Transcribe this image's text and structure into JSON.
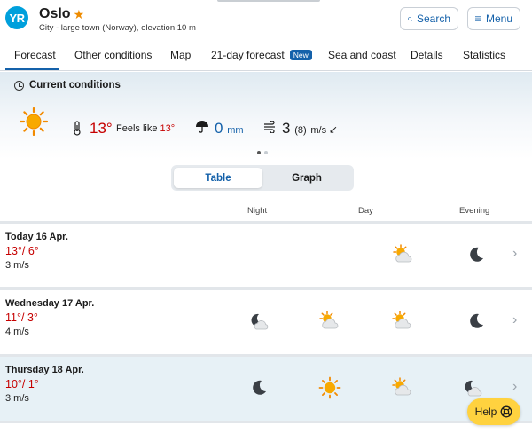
{
  "header": {
    "logo_text": "YR",
    "location": "Oslo",
    "description": "City - large town (Norway), elevation 10 m",
    "search_label": "Search",
    "menu_label": "Menu"
  },
  "tabs": [
    {
      "label": "Forecast",
      "active": true
    },
    {
      "label": "Other conditions"
    },
    {
      "label": "Map"
    },
    {
      "label": "21-day forecast",
      "badge": "New"
    },
    {
      "label": "Sea and coast"
    },
    {
      "label": "Details"
    },
    {
      "label": "Statistics"
    }
  ],
  "current": {
    "title": "Current conditions",
    "icon": "sun-icon",
    "temperature": "13°",
    "feels_like_label": "Feels like",
    "feels_like_value": "13°",
    "precipitation": "0",
    "precipitation_unit": "mm",
    "wind": "3",
    "gust": "(8)",
    "wind_unit": "m/s",
    "wind_direction_icon": "arrow-down-left-icon"
  },
  "view_toggle": {
    "table": "Table",
    "graph": "Graph",
    "selected": "Table"
  },
  "columns": {
    "night": "Night",
    "day": "Day",
    "evening": "Evening"
  },
  "days": [
    {
      "name": "Today 16 Apr.",
      "max": "13°",
      "min": "6°",
      "wind": "3 m/s",
      "night": null,
      "morning": null,
      "day": "partly-cloudy-sun-icon",
      "evening": "moon-icon"
    },
    {
      "name": "Wednesday 17 Apr.",
      "max": "11°",
      "min": "3°",
      "wind": "4 m/s",
      "night": "moon-cloud-icon",
      "morning": "partly-cloudy-sun-icon",
      "day": "partly-cloudy-sun-icon",
      "evening": "moon-icon"
    },
    {
      "name": "Thursday 18 Apr.",
      "max": "10°",
      "min": "1°",
      "wind": "3 m/s",
      "night": "moon-icon",
      "morning": "sun-icon",
      "day": "partly-cloudy-sun-icon",
      "evening": "moon-cloud-icon"
    }
  ],
  "help_label": "Help",
  "colors": {
    "brand": "#00a0dc",
    "link": "#1461aa",
    "temp": "#c60000",
    "help": "#ffd23f"
  }
}
